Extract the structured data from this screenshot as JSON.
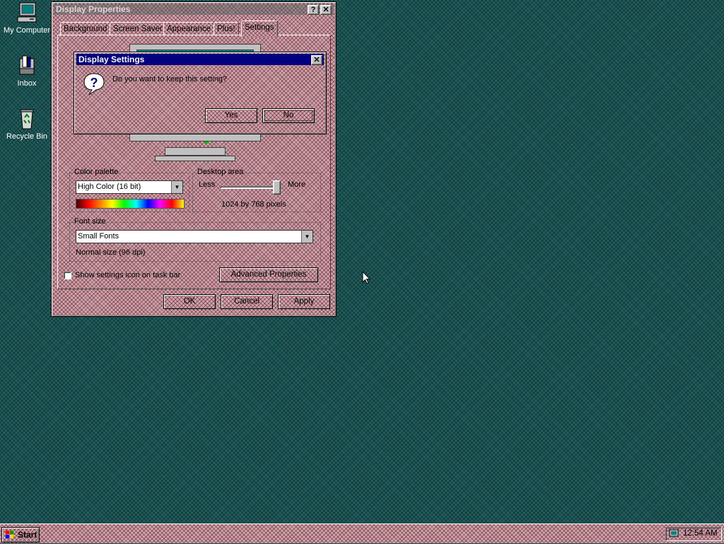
{
  "desktop": {
    "icons": [
      {
        "label": "My Computer",
        "icon": "computer-icon"
      },
      {
        "label": "Inbox",
        "icon": "inbox-icon"
      },
      {
        "label": "Recycle Bin",
        "icon": "recycle-bin-icon"
      }
    ]
  },
  "window": {
    "title": "Display Properties",
    "help_btn": "?",
    "close_btn": "✕",
    "tabs": [
      "Background",
      "Screen Saver",
      "Appearance",
      "Plus!",
      "Settings"
    ],
    "selected_tab": "Settings",
    "color_palette": {
      "label": "Color palette",
      "value": "High Color (16 bit)"
    },
    "desktop_area": {
      "label": "Desktop area",
      "less": "Less",
      "more": "More",
      "value_text": "1024 by 768 pixels",
      "slider_level": 1.0
    },
    "font_size": {
      "label": "Font size",
      "value": "Small Fonts",
      "note": "Normal size (96 dpi)"
    },
    "show_icon_checkbox": {
      "label": "Show settings icon on task bar",
      "checked": false
    },
    "advanced_button": "Advanced Properties",
    "ok_button": "OK",
    "cancel_button": "Cancel",
    "apply_button": "Apply"
  },
  "dialog": {
    "title": "Display Settings",
    "close_btn": "✕",
    "message": "Do you want to keep this setting?",
    "icon": "question-icon",
    "yes_button": "Yes",
    "no_button": "No"
  },
  "taskbar": {
    "start_label": "Start",
    "clock": "12:54 AM"
  },
  "colors": {
    "desktop": "#215e5e",
    "window_hatch": "#c9a9ad",
    "active_title": "#000080"
  }
}
